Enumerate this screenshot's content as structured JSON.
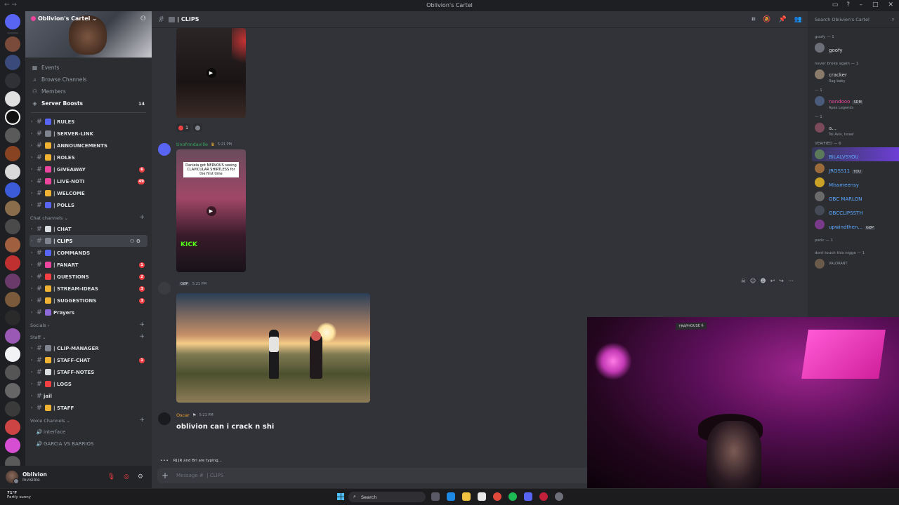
{
  "window": {
    "title": "Oblivion's Cartel"
  },
  "server": {
    "name": "Oblivion's Cartel"
  },
  "top_items": [
    {
      "icon": "calendar-icon",
      "label": "Events"
    },
    {
      "icon": "browse-icon",
      "label": "Browse Channels"
    },
    {
      "icon": "members-icon",
      "label": "Members"
    }
  ],
  "boosts": {
    "label": "Server Boosts",
    "count": "14"
  },
  "channels_top": [
    {
      "label": "| RULES",
      "color": "#5865f2"
    },
    {
      "label": "| SERVER-LINK",
      "color": "#80848e"
    },
    {
      "label": "| ANNOUNCEMENTS",
      "color": "#f0b232"
    },
    {
      "label": "| ROLES",
      "color": "#f0b232"
    },
    {
      "label": "| GIVEAWAY",
      "color": "#eb459e",
      "badge": "6"
    },
    {
      "label": "| LIVE-NOTI",
      "color": "#eb459e",
      "badge": "49"
    },
    {
      "label": "| WELCOME",
      "color": "#f0b232"
    },
    {
      "label": "| POLLS",
      "color": "#5865f2"
    }
  ],
  "categories": {
    "chat": "Chat channels",
    "socials": "Socials",
    "staff": "Staff",
    "voice": "Voice Channels"
  },
  "channels_chat": [
    {
      "label": "| CHAT",
      "color": "#dbdee1"
    },
    {
      "label": "| CLIPS",
      "color": "#80848e"
    },
    {
      "label": "| COMMANDS",
      "color": "#5865f2"
    },
    {
      "label": "| FANART",
      "color": "#eb459e",
      "badge": "1"
    },
    {
      "label": "| QUESTIONS",
      "color": "#f23f43",
      "badge": "2"
    },
    {
      "label": "| STREAM-IDEAS",
      "color": "#f0b232",
      "badge": "3"
    },
    {
      "label": "| SUGGESTIONS",
      "color": "#f0b232",
      "badge": "3"
    },
    {
      "label": "Prayers",
      "color": "#8e6ad8"
    }
  ],
  "channels_staff": [
    {
      "label": "| CLIP-MANAGER",
      "color": "#80848e"
    },
    {
      "label": "| STAFF-CHAT",
      "color": "#f0b232",
      "badge": "1"
    },
    {
      "label": "| STAFF-NOTES",
      "color": "#dbdee1"
    },
    {
      "label": "| LOGS",
      "color": "#f23f43"
    },
    {
      "label": "jail",
      "color": ""
    },
    {
      "label": "| STAFF",
      "color": "#f0b232"
    }
  ],
  "voice_channels": [
    "interface",
    "GARCIA VS BARRIOS"
  ],
  "user": {
    "name": "Oblivion",
    "status": "Invisible"
  },
  "channel": {
    "name": "| CLIPS"
  },
  "messages": [
    {
      "author": "tinofrmdaville",
      "time": "5:21 PM",
      "caption": "Daniela got NERVOUS seeing CLAVICULAR SHIRTLESS for the first time",
      "kick": "KICK"
    },
    {
      "author": "",
      "tag": "GØP",
      "time": "5:21 PM"
    },
    {
      "author": "Oscar",
      "time": "5:21 PM",
      "text": "oblivion can i crack n shi"
    }
  ],
  "reactions": [
    {
      "count": "1"
    }
  ],
  "typing": {
    "names": "RJ JR and Bri",
    "suffix": "are typing..."
  },
  "composer": {
    "placeholder": "Message #  | CLIPS"
  },
  "member_search": {
    "placeholder": "Search Oblivion's Cartel"
  },
  "member_groups": [
    {
      "title": "goofy — 1",
      "members": [
        {
          "name": "goofy",
          "color": "#dbdee1"
        }
      ]
    },
    {
      "title": "never broke again — 1",
      "members": [
        {
          "name": "cracker",
          "sub": "Rag baby",
          "color": "#dbdee1"
        }
      ]
    },
    {
      "title": "— 1",
      "members": [
        {
          "name": "nandooo",
          "tag": "SDM",
          "sub": "Apex Legends",
          "color": "#eb459e"
        }
      ]
    },
    {
      "title": "— 1",
      "members": [
        {
          "name": "a...",
          "sub": "Tel Aviv, Israel",
          "color": "#dbdee1"
        }
      ]
    },
    {
      "title": "VERIFIED — 6",
      "members": [
        {
          "name": "BILALVSYOU",
          "color": "#5ea9ff"
        },
        {
          "name": "JROSS11",
          "tag": "TDU",
          "color": "#5ea9ff"
        },
        {
          "name": "Missmeensy",
          "color": "#5ea9ff"
        },
        {
          "name": "OBC MARLON",
          "color": "#5ea9ff"
        },
        {
          "name": "OBCCLIPSSTH",
          "color": "#5ea9ff"
        },
        {
          "name": "upwindthen...",
          "tag": "GØP",
          "color": "#5ea9ff"
        }
      ]
    },
    {
      "title": "patic — 1",
      "members": []
    },
    {
      "title": "dont touch this nigga — 1",
      "members": [
        {
          "name": "",
          "sub": "VALORANT",
          "color": "#dbdee1"
        }
      ]
    }
  ],
  "webcam": {
    "sign": "TRAPHOUSE 6"
  },
  "taskbar": {
    "weather_temp": "71°F",
    "weather_desc": "Partly sunny",
    "search": "Search"
  }
}
